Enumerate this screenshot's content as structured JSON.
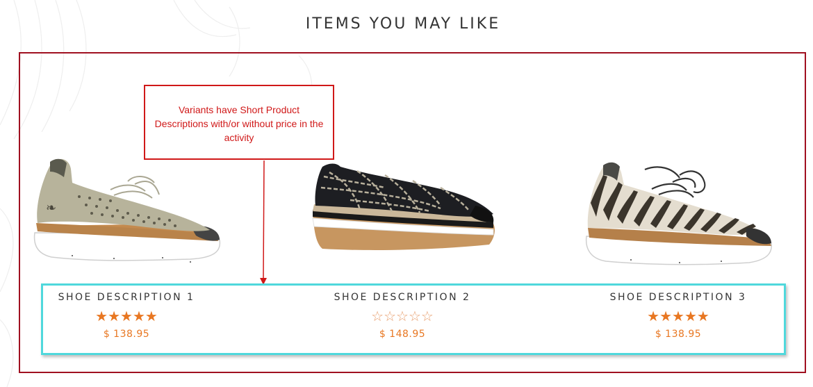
{
  "section": {
    "title": "ITEMS YOU MAY LIKE"
  },
  "annotation": {
    "text": "Variants have Short Product Descriptions with/or without price in the activity"
  },
  "products": [
    {
      "name": "SHOE DESCRIPTION 1",
      "rating": 5,
      "max_rating": 5,
      "price": "$ 138.95",
      "image": "beige-perforated-sneaker"
    },
    {
      "name": "SHOE DESCRIPTION 2",
      "rating": 0,
      "max_rating": 5,
      "price": "$ 148.95",
      "image": "black-striped-slip-on"
    },
    {
      "name": "SHOE DESCRIPTION 3",
      "rating": 5,
      "max_rating": 5,
      "price": "$ 138.95",
      "image": "zebra-print-sneaker"
    }
  ],
  "colors": {
    "accent": "#e87722",
    "frame": "#a01020",
    "callout": "#d01818",
    "highlight": "#4fd8dc"
  }
}
